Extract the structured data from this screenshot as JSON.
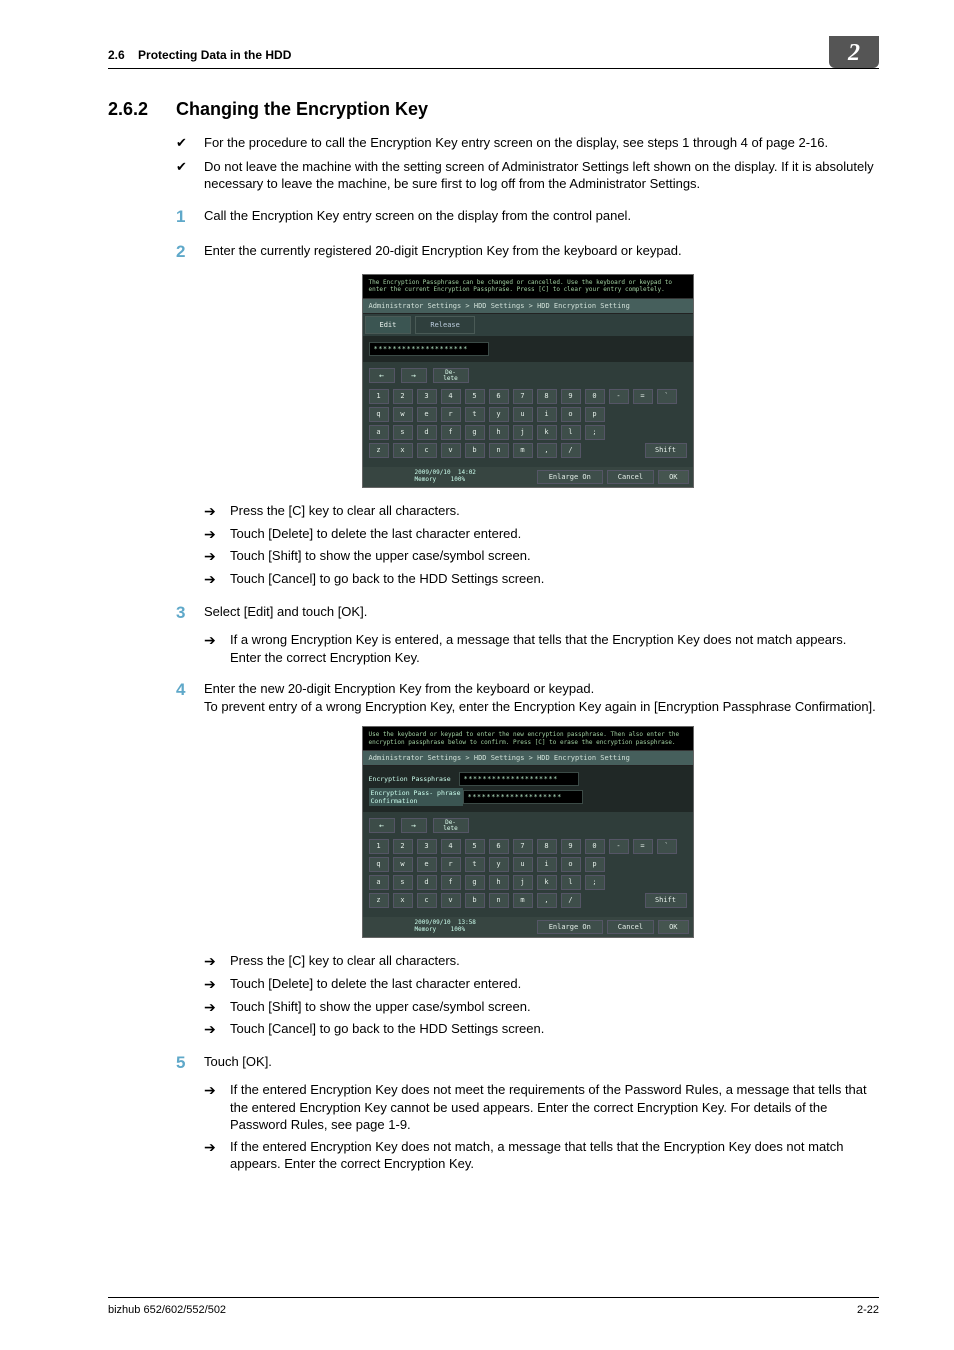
{
  "running_head": {
    "section_no": "2.6",
    "section_title": "Protecting Data in the HDD"
  },
  "chapter_tab": "2",
  "heading": {
    "number": "2.6.2",
    "title": "Changing the Encryption Key"
  },
  "prechecks": [
    "For the procedure to call the Encryption Key entry screen on the display, see steps 1 through 4 of page 2-16.",
    "Do not leave the machine with the setting screen of Administrator Settings left shown on the display. If it is absolutely necessary to leave the machine, be sure first to log off from the Administrator Settings."
  ],
  "steps": {
    "s1": {
      "num": "1",
      "text": "Call the Encryption Key entry screen on the display from the control panel."
    },
    "s2": {
      "num": "2",
      "text": "Enter the currently registered 20-digit Encryption Key from the keyboard or keypad."
    },
    "s3": {
      "num": "3",
      "text": "Select [Edit] and touch [OK]."
    },
    "s4": {
      "num": "4",
      "text": "Enter the new 20-digit Encryption Key from the keyboard or keypad.\nTo prevent entry of a wrong Encryption Key, enter the Encryption Key again in [Encryption Passphrase Confirmation]."
    },
    "s5": {
      "num": "5",
      "text": "Touch [OK]."
    }
  },
  "substeps_after_shot1": [
    "Press the [C] key to clear all characters.",
    "Touch [Delete] to delete the last character entered.",
    "Touch [Shift] to show the upper case/symbol screen.",
    "Touch [Cancel] to go back to the HDD Settings screen."
  ],
  "substeps_after_s3": [
    "If a wrong Encryption Key is entered, a message that tells that the Encryption Key does not match appears. Enter the correct Encryption Key."
  ],
  "substeps_after_shot2": [
    "Press the [C] key to clear all characters.",
    "Touch [Delete] to delete the last character entered.",
    "Touch [Shift] to show the upper case/symbol screen.",
    "Touch [Cancel] to go back to the HDD Settings screen."
  ],
  "substeps_after_s5": [
    "If the entered Encryption Key does not meet the requirements of the Password Rules, a message that tells that the entered Encryption Key cannot be used appears. Enter the correct Encryption Key. For details of the Password Rules, see page 1-9.",
    "If the entered Encryption Key does not match, a message that tells that the Encryption Key does not match appears. Enter the correct Encryption Key."
  ],
  "shot1": {
    "topmsg": "The Encryption Passphrase can be changed or cancelled. Use the keyboard or keypad to enter the current Encryption Passphrase. Press [C] to clear your entry completely.",
    "crumb": "Administrator Settings > HDD Settings > HDD Encryption Setting",
    "tabs": {
      "edit": "Edit",
      "release": "Release"
    },
    "field_value": "********************",
    "nav": {
      "left": "←",
      "right": "→",
      "delete": "De-\nlete"
    },
    "rows": [
      [
        "1",
        "2",
        "3",
        "4",
        "5",
        "6",
        "7",
        "8",
        "9",
        "0",
        "-",
        "=",
        "`"
      ],
      [
        "q",
        "w",
        "e",
        "r",
        "t",
        "y",
        "u",
        "i",
        "o",
        "p"
      ],
      [
        "a",
        "s",
        "d",
        "f",
        "g",
        "h",
        "j",
        "k",
        "l",
        ";"
      ],
      [
        "z",
        "x",
        "c",
        "v",
        "b",
        "n",
        "m",
        ",",
        "/"
      ]
    ],
    "shift": "Shift",
    "footer": {
      "date": "2009/09/10",
      "time": "14:02",
      "mem": "Memory",
      "pct": "100%",
      "enlarge": "Enlarge On",
      "cancel": "Cancel",
      "ok": "OK"
    }
  },
  "shot2": {
    "topmsg": "Use the keyboard or keypad to enter the new encryption passphrase. Then also enter the encryption passphrase below to confirm. Press [C] to erase the encryption passphrase.",
    "crumb": "Administrator Settings > HDD Settings > HDD Encryption Setting",
    "labels": {
      "pass": "Encryption Passphrase",
      "conf": "Encryption Pass- phrase Confirmation"
    },
    "field_value1": "********************",
    "field_value2": "********************",
    "nav": {
      "left": "←",
      "right": "→",
      "delete": "De-\nlete"
    },
    "rows": [
      [
        "1",
        "2",
        "3",
        "4",
        "5",
        "6",
        "7",
        "8",
        "9",
        "0",
        "-",
        "=",
        "`"
      ],
      [
        "q",
        "w",
        "e",
        "r",
        "t",
        "y",
        "u",
        "i",
        "o",
        "p"
      ],
      [
        "a",
        "s",
        "d",
        "f",
        "g",
        "h",
        "j",
        "k",
        "l",
        ";"
      ],
      [
        "z",
        "x",
        "c",
        "v",
        "b",
        "n",
        "m",
        ",",
        "/"
      ]
    ],
    "shift": "Shift",
    "footer": {
      "date": "2009/09/10",
      "time": "13:58",
      "mem": "Memory",
      "pct": "100%",
      "enlarge": "Enlarge On",
      "cancel": "Cancel",
      "ok": "OK"
    }
  },
  "footer": {
    "product": "bizhub 652/602/552/502",
    "page": "2-22"
  }
}
